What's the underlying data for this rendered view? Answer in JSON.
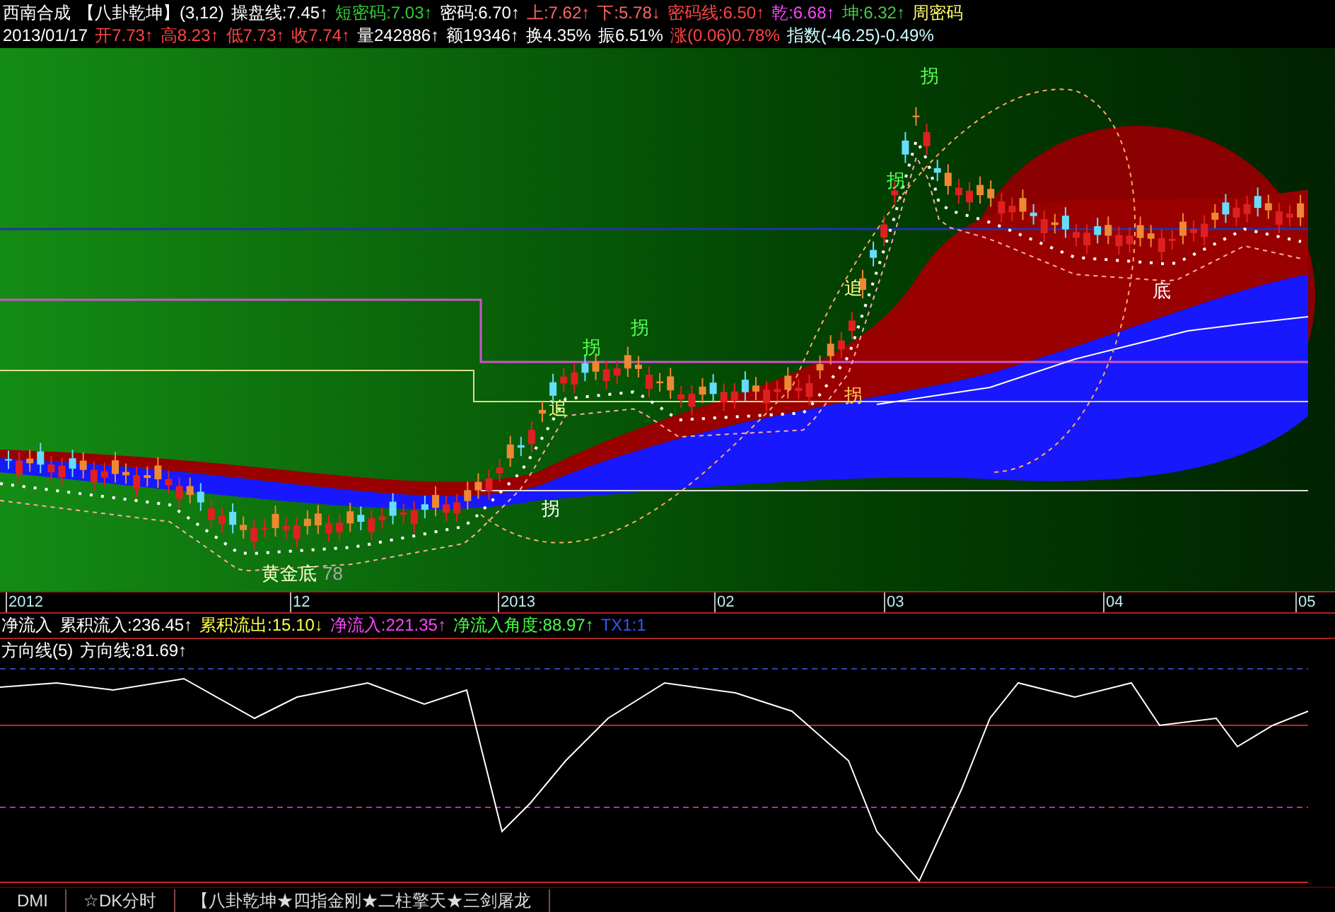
{
  "header_line_1": [
    {
      "text": "西南合成",
      "color": "#ffffff"
    },
    {
      "text": "【八卦乾坤】(3,12)",
      "color": "#ffffff"
    },
    {
      "text": "操盘线:7.45↑",
      "color": "#ffffff"
    },
    {
      "text": "短密码:7.03↑",
      "color": "#33cc33"
    },
    {
      "text": "密码:6.70↑",
      "color": "#ffffff"
    },
    {
      "text": "上:7.62↑",
      "color": "#ff6666"
    },
    {
      "text": "下:5.78↓",
      "color": "#ff6666"
    },
    {
      "text": "密码线:6.50↑",
      "color": "#ff4444"
    },
    {
      "text": "乾:6.68↑",
      "color": "#ff44ff"
    },
    {
      "text": "坤:6.32↑",
      "color": "#44cc44"
    },
    {
      "text": "周密码",
      "color": "#ffff66"
    }
  ],
  "header_line_2": [
    {
      "text": "2013/01/17",
      "color": "#ffffff"
    },
    {
      "text": "开7.73↑",
      "color": "#ff4444"
    },
    {
      "text": "高8.23↑",
      "color": "#ff4444"
    },
    {
      "text": "低7.73↑",
      "color": "#ff4444"
    },
    {
      "text": "收7.74↑",
      "color": "#ff4444"
    },
    {
      "text": "量242886↑",
      "color": "#ffffff"
    },
    {
      "text": "额19346↑",
      "color": "#ffffff"
    },
    {
      "text": "换4.35%",
      "color": "#ffffff"
    },
    {
      "text": "振6.51%",
      "color": "#ffffff"
    },
    {
      "text": "涨(0.06)0.78%",
      "color": "#ff4444"
    },
    {
      "text": "指数(-46.25)-0.49%",
      "color": "#ccffff"
    }
  ],
  "chart_marks": [
    {
      "text": "拐",
      "color": "#55ff55"
    },
    {
      "text": "拐",
      "color": "#55ff55"
    },
    {
      "text": "追",
      "color": "#ffff88"
    },
    {
      "text": "拐",
      "color": "#ffffff"
    },
    {
      "text": "拐",
      "color": "#55ff55"
    },
    {
      "text": "拐",
      "color": "#55ff55"
    },
    {
      "text": "追",
      "color": "#ffff88"
    },
    {
      "text": "拐",
      "color": "#ffcc55"
    },
    {
      "text": "底",
      "color": "#ffffff"
    },
    {
      "text": "黄金底",
      "color": "#ffffcc"
    },
    {
      "text": "78",
      "color": "#aaaaaa"
    }
  ],
  "time_axis": [
    "2012",
    "12",
    "2013",
    "02",
    "03",
    "04",
    "05"
  ],
  "indicator_line_1": [
    {
      "text": "净流入",
      "color": "#ffffff"
    },
    {
      "text": "累积流入:236.45↑",
      "color": "#ffffff"
    },
    {
      "text": "累积流出:15.10↓",
      "color": "#ffff44"
    },
    {
      "text": "净流入:221.35↑",
      "color": "#ff44ff"
    },
    {
      "text": "净流入角度:88.97↑",
      "color": "#44ff44"
    },
    {
      "text": "TX1:1",
      "color": "#3355ff"
    }
  ],
  "indicator_line_2": [
    {
      "text": "方向线(5)",
      "color": "#ffffff"
    },
    {
      "text": "方向线:81.69↑",
      "color": "#ffffff"
    }
  ],
  "bottom_tabs": [
    "DMI",
    "☆DK分时",
    "【八卦乾坤★四指金刚★二柱擎天★三剑屠龙"
  ]
}
